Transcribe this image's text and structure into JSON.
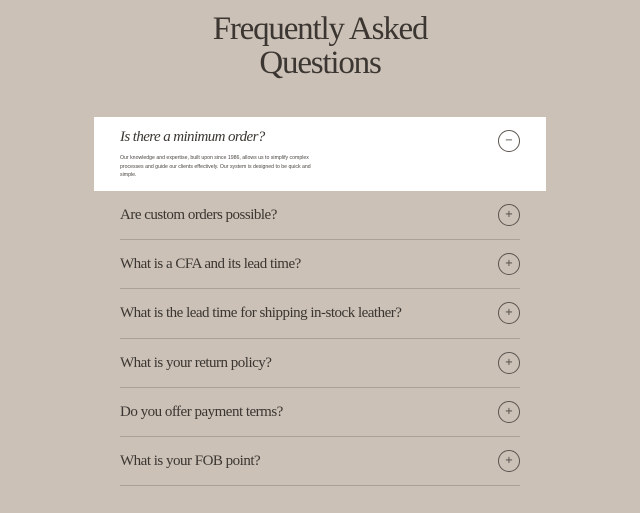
{
  "title": {
    "line1": "Frequently Asked",
    "line2": "Questions"
  },
  "faq": [
    {
      "question": "Is there a minimum order?",
      "answer": "Our knowledge and expertise, built upon since 1986, allows us to simplify complex processes and guide our clients effectively. Our system is designed to be quick and simple.",
      "expanded": true,
      "toggle_symbol": "−",
      "toggle_icon": "minus-circle-icon"
    },
    {
      "question": "Are custom orders possible?",
      "expanded": false,
      "toggle_symbol": "+",
      "toggle_icon": "plus-circle-icon"
    },
    {
      "question": "What is a CFA and its lead time?",
      "expanded": false,
      "toggle_symbol": "+",
      "toggle_icon": "plus-circle-icon"
    },
    {
      "question": "What is the lead time for shipping in-stock leather?",
      "expanded": false,
      "toggle_symbol": "+",
      "toggle_icon": "plus-circle-icon"
    },
    {
      "question": "What is your return policy?",
      "expanded": false,
      "toggle_symbol": "+",
      "toggle_icon": "plus-circle-icon"
    },
    {
      "question": "Do you offer payment terms?",
      "expanded": false,
      "toggle_symbol": "+",
      "toggle_icon": "plus-circle-icon"
    },
    {
      "question": "What is your FOB point?",
      "expanded": false,
      "toggle_symbol": "+",
      "toggle_icon": "plus-circle-icon"
    }
  ],
  "colors": {
    "background": "#cbc1b7",
    "panel": "#ffffff",
    "text": "#3b3631",
    "divider": "#a9a097"
  }
}
